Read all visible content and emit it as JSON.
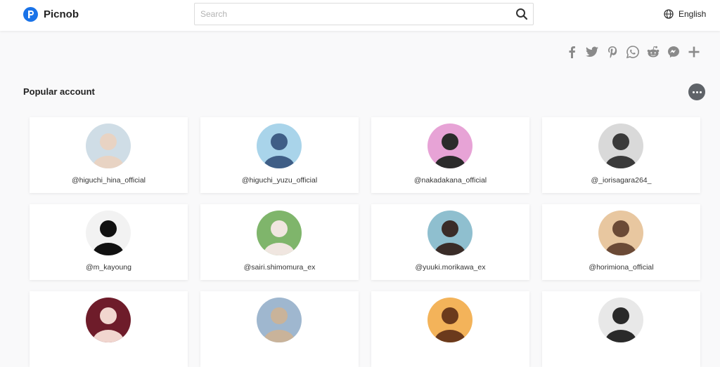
{
  "header": {
    "brand": "Picnob",
    "search_placeholder": "Search",
    "language": "English"
  },
  "share_icons": [
    "facebook-icon",
    "twitter-icon",
    "pinterest-icon",
    "whatsapp-icon",
    "reddit-icon",
    "messenger-icon",
    "plus-icon"
  ],
  "section": {
    "title": "Popular account"
  },
  "accounts": [
    {
      "username": "@higuchi_hina_official",
      "avatar_bg": "#cfdde6",
      "avatar_fg": "#e8d3c3"
    },
    {
      "username": "@higuchi_yuzu_official",
      "avatar_bg": "#a9d4ea",
      "avatar_fg": "#3f5e86"
    },
    {
      "username": "@nakadakana_official",
      "avatar_bg": "#e7a3d6",
      "avatar_fg": "#2b2b2b"
    },
    {
      "username": "@_iorisagara264_",
      "avatar_bg": "#d9d9d9",
      "avatar_fg": "#3a3a3a"
    },
    {
      "username": "@m_kayoung",
      "avatar_bg": "#f2f2f2",
      "avatar_fg": "#111111"
    },
    {
      "username": "@sairi.shimomura_ex",
      "avatar_bg": "#7fb56b",
      "avatar_fg": "#f0e6e0"
    },
    {
      "username": "@yuuki.morikawa_ex",
      "avatar_bg": "#8fbfcf",
      "avatar_fg": "#3a2c28"
    },
    {
      "username": "@horimiona_official",
      "avatar_bg": "#e8c7a0",
      "avatar_fg": "#6b4a36"
    },
    {
      "username": "",
      "avatar_bg": "#6e1c2a",
      "avatar_fg": "#f1d6cf"
    },
    {
      "username": "",
      "avatar_bg": "#9fb7cf",
      "avatar_fg": "#c9b39a"
    },
    {
      "username": "",
      "avatar_bg": "#f3b35a",
      "avatar_fg": "#6b3a1c"
    },
    {
      "username": "",
      "avatar_bg": "#e8e8e8",
      "avatar_fg": "#2a2a2a"
    }
  ]
}
